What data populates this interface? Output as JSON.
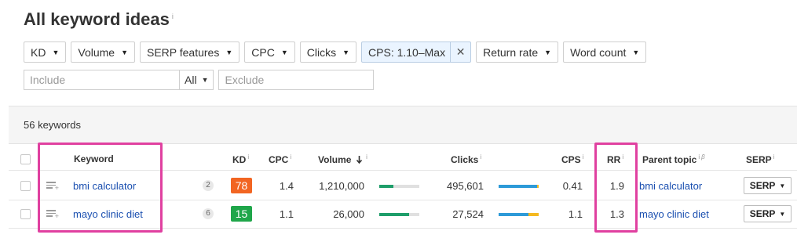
{
  "page": {
    "title": "All keyword ideas",
    "title_info": "i"
  },
  "filters": [
    {
      "label": "KD"
    },
    {
      "label": "Volume"
    },
    {
      "label": "SERP features"
    },
    {
      "label": "CPC"
    },
    {
      "label": "Clicks"
    },
    {
      "label": "CPS: 1.10–Max",
      "active": true,
      "close": "✕"
    },
    {
      "label": "Return rate"
    },
    {
      "label": "Word count"
    }
  ],
  "search": {
    "include_placeholder": "Include",
    "mode": "All",
    "exclude_placeholder": "Exclude"
  },
  "results": {
    "count": "56 keywords"
  },
  "columns": {
    "keyword": "Keyword",
    "kd": "KD",
    "cpc": "CPC",
    "volume": "Volume",
    "volume_sort_icon": "arrow-down",
    "clicks": "Clicks",
    "cps": "CPS",
    "rr": "RR",
    "parent_topic": "Parent topic",
    "parent_topic_beta": "β",
    "serp": "SERP",
    "info": "i"
  },
  "rows": [
    {
      "keyword": "bmi calculator",
      "serp_features": "2",
      "kd": "78",
      "kd_color": "#f26522",
      "cpc": "1.4",
      "volume": "1,210,000",
      "volume_fraction": 0.35,
      "clicks": "495,601",
      "clicks_organic_fraction": 0.97,
      "clicks_paid_fraction": 0.03,
      "cps": "0.41",
      "rr": "1.9",
      "parent_topic": "bmi calculator",
      "serp": "SERP"
    },
    {
      "keyword": "mayo clinic diet",
      "serp_features": "6",
      "kd": "15",
      "kd_color": "#1fa64a",
      "cpc": "1.1",
      "volume": "26,000",
      "volume_fraction": 0.75,
      "clicks": "27,524",
      "clicks_organic_fraction": 0.75,
      "clicks_paid_fraction": 0.25,
      "cps": "1.1",
      "rr": "1.3",
      "parent_topic": "mayo clinic diet",
      "serp": "SERP"
    }
  ],
  "colors": {
    "link": "#1a4fb0",
    "volume_bar": "#1e9e6a",
    "clicks_organic": "#2d9ad8",
    "clicks_paid": "#f5b920",
    "highlight": "#e040a0",
    "active_filter_bg": "#eaf4ff"
  }
}
